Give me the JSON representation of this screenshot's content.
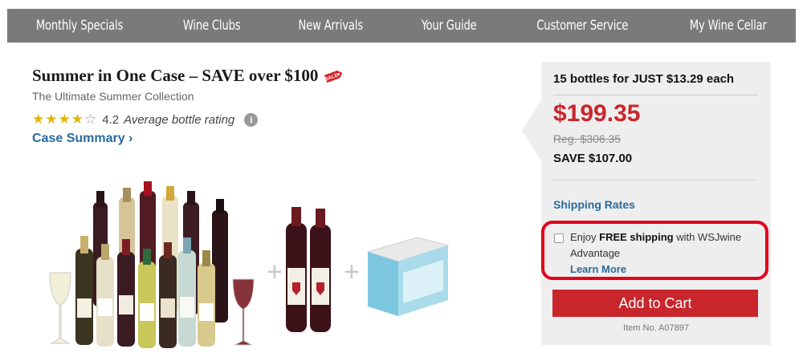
{
  "nav": {
    "items": [
      "Monthly Specials",
      "Wine Clubs",
      "New Arrivals",
      "Your Guide",
      "Customer Service",
      "My Wine Cellar"
    ]
  },
  "product": {
    "title": "Summer in One Case – SAVE over $100",
    "sale_badge": "SALE",
    "subtitle": "The Ultimate Summer Collection",
    "rating_value": "4.2",
    "rating_stars": 4,
    "rating_label": "Average bottle rating",
    "case_summary_link": "Case Summary ›"
  },
  "pricing": {
    "per_bottle": "15 bottles for JUST $13.29 each",
    "price": "$199.35",
    "regular_price": "Reg. $306.35",
    "savings": "SAVE $107.00",
    "shipping_rates_link": "Shipping Rates",
    "advantage": {
      "prefix": "Enjoy ",
      "highlight": "FREE shipping",
      "suffix": " with WSJwine Advantage",
      "learn_more": "Learn More"
    },
    "add_to_cart": "Add to Cart",
    "item_number": "Item No. A07897"
  },
  "colors": {
    "nav_bg": "#7a7a7a",
    "price_red": "#c9262c",
    "link_blue": "#2a6a9e",
    "highlight_border": "#e0001b",
    "panel_bg": "#eeeeee"
  }
}
